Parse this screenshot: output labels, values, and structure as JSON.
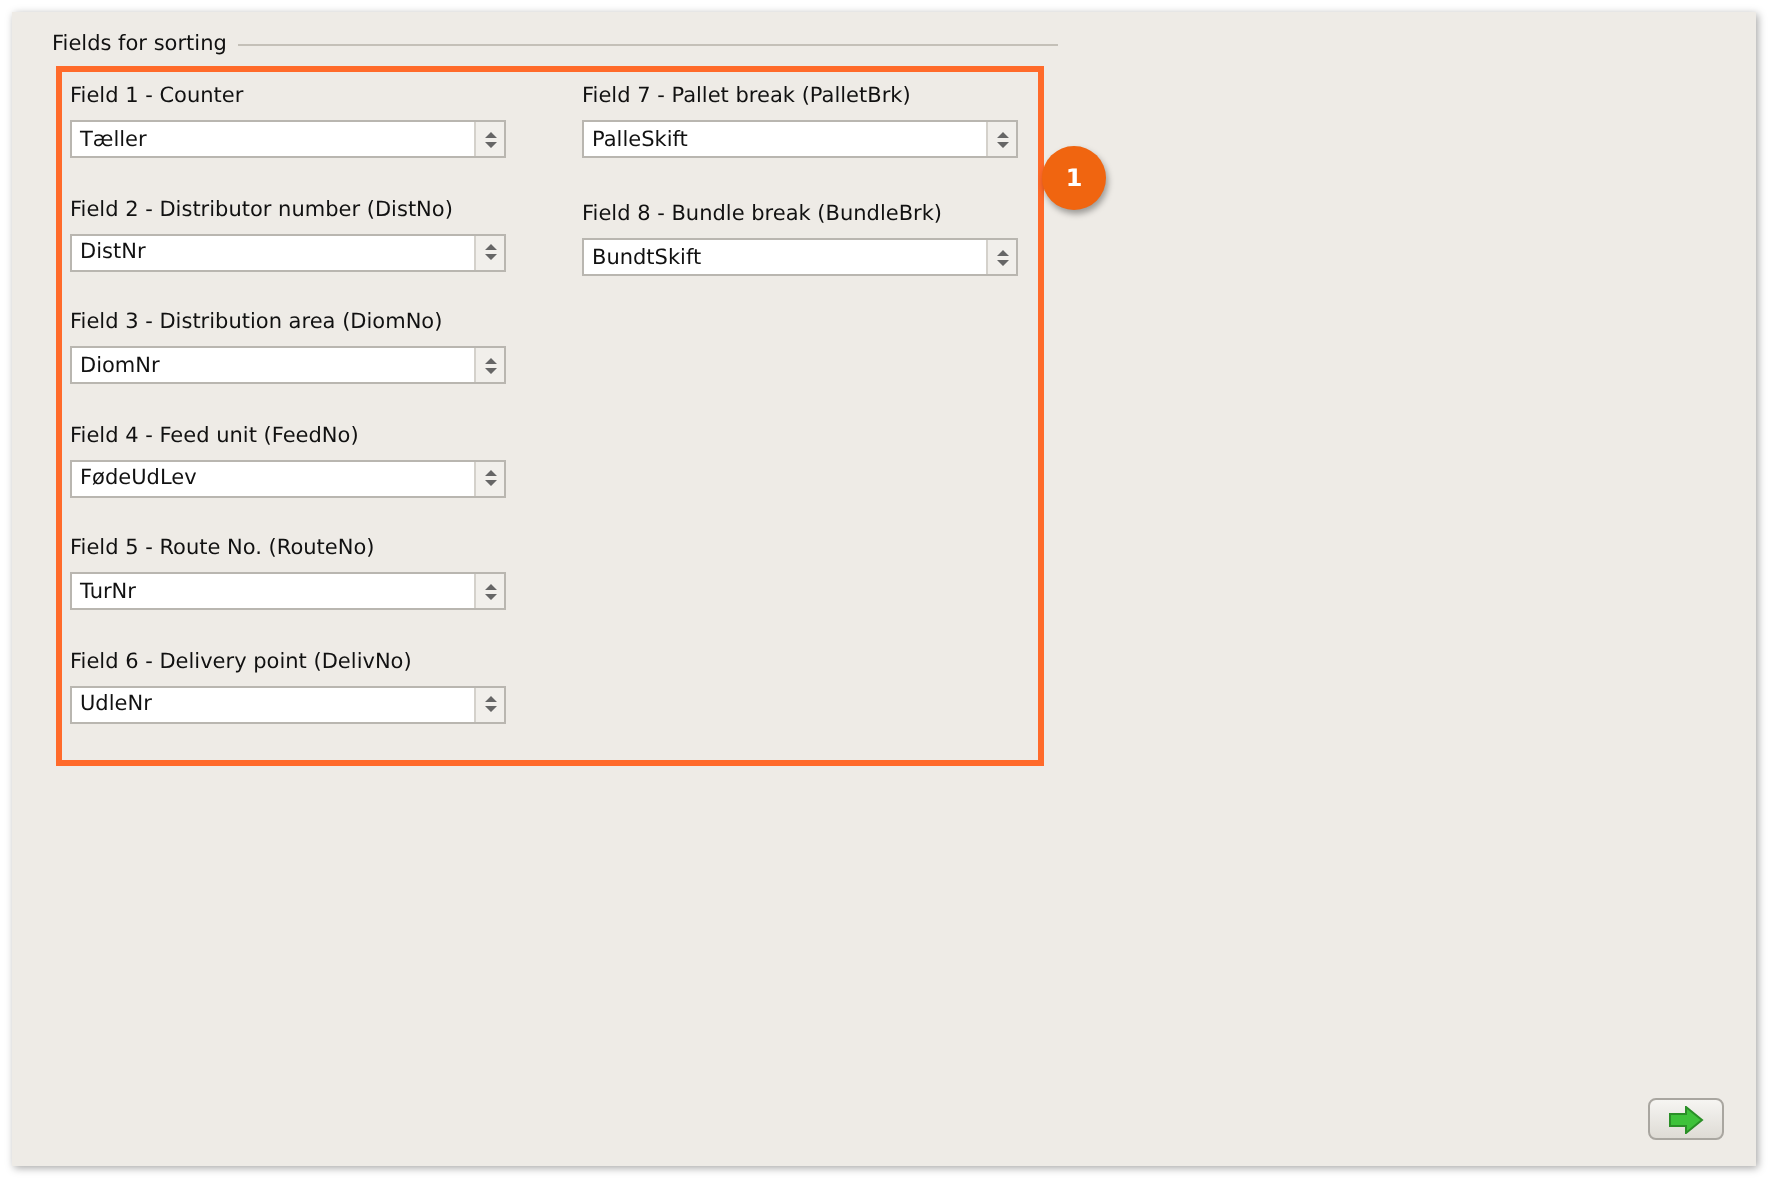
{
  "group": {
    "title": "Fields for sorting"
  },
  "columns": [
    [
      {
        "label": "Field 1 - Counter",
        "value": "Tæller"
      },
      {
        "label": "Field 2 - Distributor number (DistNo)",
        "value": "DistNr"
      },
      {
        "label": "Field 3 - Distribution area (DiomNo)",
        "value": "DiomNr"
      },
      {
        "label": "Field 4 - Feed unit (FeedNo)",
        "value": "FødeUdLev"
      },
      {
        "label": "Field 5 - Route No. (RouteNo)",
        "value": "TurNr"
      },
      {
        "label": "Field 6 - Delivery point (DelivNo)",
        "value": "UdleNr"
      }
    ],
    [
      {
        "label": "Field 7 - Pallet break (PalletBrk)",
        "value": "PalleSkift"
      },
      {
        "label": "Field 8 - Bundle break (BundleBrk)",
        "value": "BundtSkift"
      }
    ]
  ],
  "callout": {
    "number": "1"
  }
}
